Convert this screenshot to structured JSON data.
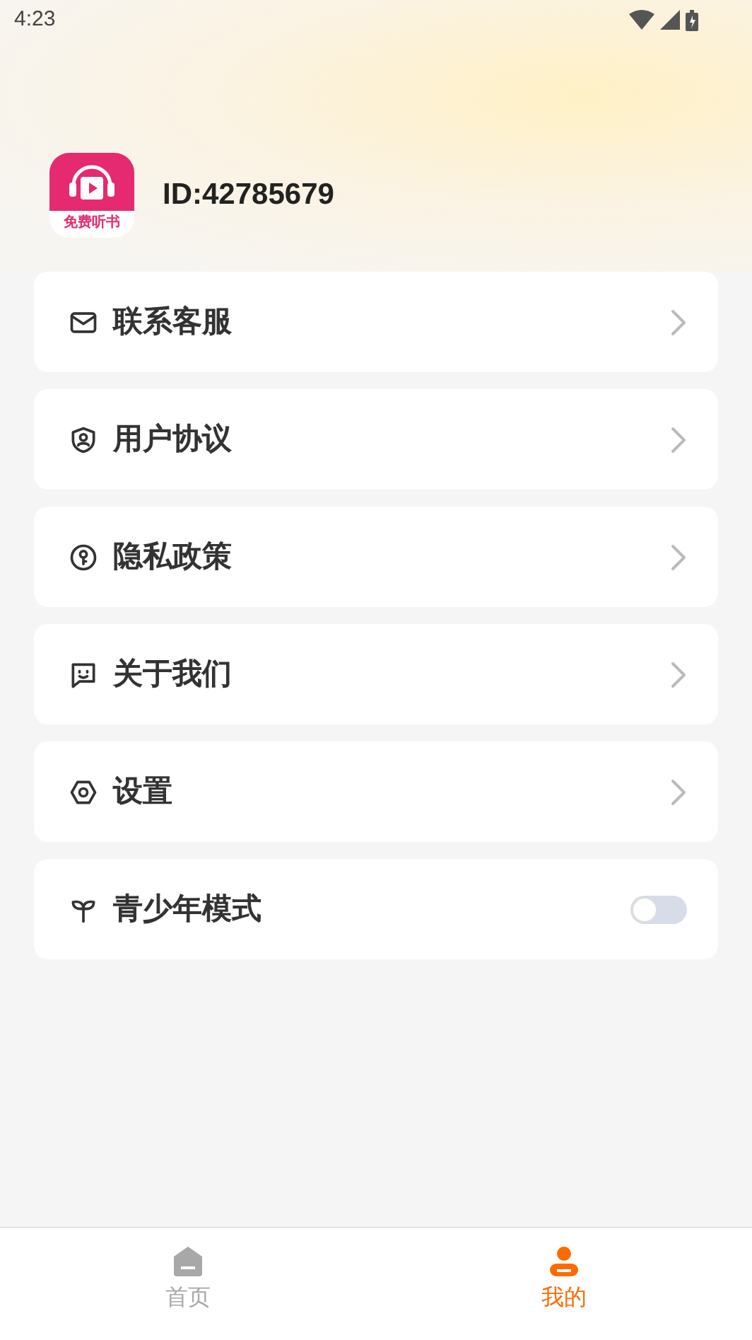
{
  "status_bar": {
    "time": "4:23"
  },
  "profile": {
    "logo_text": "免费听书",
    "id": "ID:42785679"
  },
  "menu": [
    {
      "kind": "link",
      "label": "联系客服"
    },
    {
      "kind": "link",
      "label": "用户协议"
    },
    {
      "kind": "link",
      "label": "隐私政策"
    },
    {
      "kind": "link",
      "label": "关于我们"
    },
    {
      "kind": "link",
      "label": "设置"
    },
    {
      "kind": "toggle",
      "label": "青少年模式",
      "on": false
    }
  ],
  "tabs": [
    {
      "label": "首页",
      "selected": false
    },
    {
      "label": "我的",
      "selected": true
    }
  ]
}
